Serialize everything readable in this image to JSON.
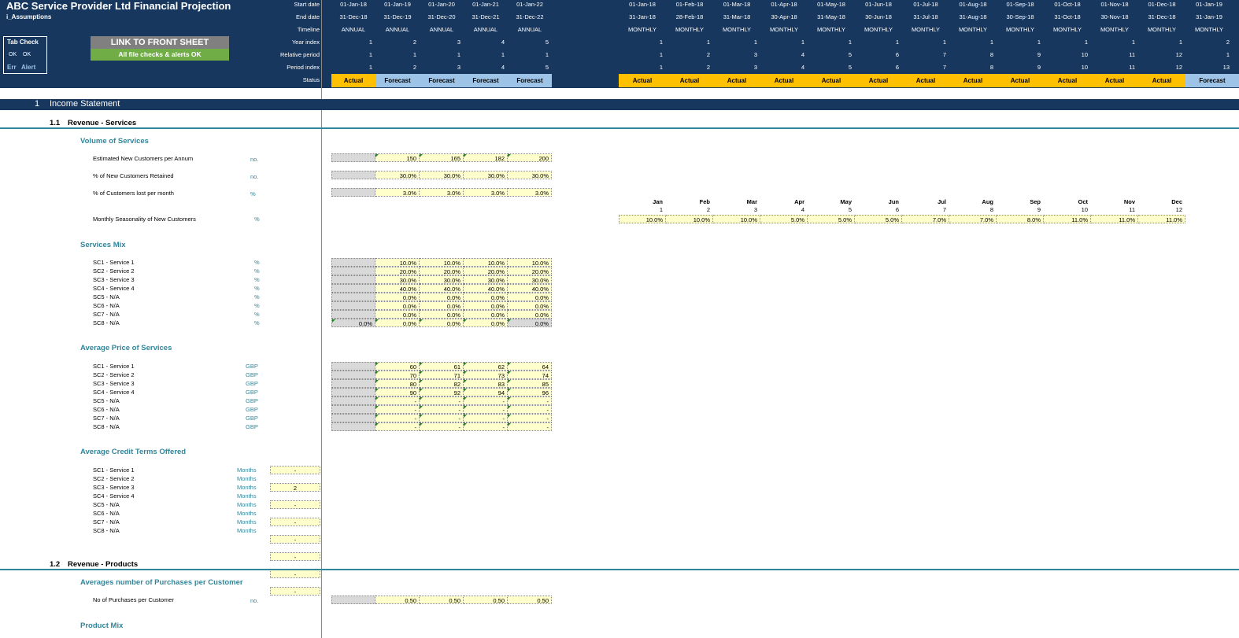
{
  "app": {
    "title": "ABC Service Provider Ltd Financial Projection",
    "sheet_name": "i_Assumptions"
  },
  "tab_check": {
    "title": "Tab Check",
    "ok1": "OK",
    "ok2": "OK",
    "err": "Err",
    "alert": "Alert"
  },
  "buttons": {
    "link_front_sheet": "LINK TO FRONT SHEET",
    "file_checks": "All file checks & alerts OK"
  },
  "header_labels": [
    "Start date",
    "End date",
    "Timeline",
    "Year index",
    "Relative period",
    "Period index",
    "Status"
  ],
  "annual": {
    "start": [
      "01-Jan-18",
      "01-Jan-19",
      "01-Jan-20",
      "01-Jan-21",
      "01-Jan-22"
    ],
    "end": [
      "31-Dec-18",
      "31-Dec-19",
      "31-Dec-20",
      "31-Dec-21",
      "31-Dec-22"
    ],
    "timeline": [
      "ANNUAL",
      "ANNUAL",
      "ANNUAL",
      "ANNUAL",
      "ANNUAL"
    ],
    "year_index": [
      "1",
      "2",
      "3",
      "4",
      "5"
    ],
    "relative": [
      "1",
      "1",
      "1",
      "1",
      "1"
    ],
    "period": [
      "1",
      "2",
      "3",
      "4",
      "5"
    ],
    "status": [
      "Actual",
      "Forecast",
      "Forecast",
      "Forecast",
      "Forecast"
    ]
  },
  "monthly": {
    "start": [
      "01-Jan-18",
      "01-Feb-18",
      "01-Mar-18",
      "01-Apr-18",
      "01-May-18",
      "01-Jun-18",
      "01-Jul-18",
      "01-Aug-18",
      "01-Sep-18",
      "01-Oct-18",
      "01-Nov-18",
      "01-Dec-18",
      "01-Jan-19"
    ],
    "end": [
      "31-Jan-18",
      "28-Feb-18",
      "31-Mar-18",
      "30-Apr-18",
      "31-May-18",
      "30-Jun-18",
      "31-Jul-18",
      "31-Aug-18",
      "30-Sep-18",
      "31-Oct-18",
      "30-Nov-18",
      "31-Dec-18",
      "31-Jan-19"
    ],
    "timeline": [
      "MONTHLY",
      "MONTHLY",
      "MONTHLY",
      "MONTHLY",
      "MONTHLY",
      "MONTHLY",
      "MONTHLY",
      "MONTHLY",
      "MONTHLY",
      "MONTHLY",
      "MONTHLY",
      "MONTHLY",
      "MONTHLY"
    ],
    "year_index": [
      "1",
      "1",
      "1",
      "1",
      "1",
      "1",
      "1",
      "1",
      "1",
      "1",
      "1",
      "1",
      "2"
    ],
    "relative": [
      "1",
      "2",
      "3",
      "4",
      "5",
      "6",
      "7",
      "8",
      "9",
      "10",
      "11",
      "12",
      "1"
    ],
    "period": [
      "1",
      "2",
      "3",
      "4",
      "5",
      "6",
      "7",
      "8",
      "9",
      "10",
      "11",
      "12",
      "13"
    ],
    "status": [
      "Actual",
      "Actual",
      "Actual",
      "Actual",
      "Actual",
      "Actual",
      "Actual",
      "Actual",
      "Actual",
      "Actual",
      "Actual",
      "Actual",
      "Forecast"
    ]
  },
  "sections": {
    "s1_num": "1",
    "s1_title": "Income Statement",
    "s11_num": "1.1",
    "s11_title": "Revenue - Services",
    "s12_num": "1.2",
    "s12_title": "Revenue - Products"
  },
  "volume": {
    "title": "Volume of Services",
    "rows": [
      {
        "label": "Estimated New Customers per Annum",
        "unit": "no.",
        "values": [
          "150",
          "165",
          "182",
          "200"
        ]
      },
      {
        "label": "% of New Customers Retained",
        "unit": "no.",
        "values": [
          "30.0%",
          "30.0%",
          "30.0%",
          "30.0%"
        ]
      },
      {
        "label": "% of Customers lost per month",
        "unit": "%",
        "values": [
          "3.0%",
          "3.0%",
          "3.0%",
          "3.0%"
        ]
      }
    ],
    "seasonality_label": "Monthly Seasonality of New Customers",
    "seasonality_unit": "%",
    "months": [
      "Jan",
      "Feb",
      "Mar",
      "Apr",
      "May",
      "Jun",
      "Jul",
      "Aug",
      "Sep",
      "Oct",
      "Nov",
      "Dec"
    ],
    "month_idx": [
      "1",
      "2",
      "3",
      "4",
      "5",
      "6",
      "7",
      "8",
      "9",
      "10",
      "11",
      "12"
    ],
    "seasonality": [
      "10.0%",
      "10.0%",
      "10.0%",
      "5.0%",
      "5.0%",
      "5.0%",
      "7.0%",
      "7.0%",
      "8.0%",
      "11.0%",
      "11.0%",
      "11.0%"
    ]
  },
  "mix": {
    "title": "Services Mix",
    "rows": [
      {
        "label": "SC1 - Service 1",
        "unit": "%",
        "values": [
          "10.0%",
          "10.0%",
          "10.0%",
          "10.0%"
        ]
      },
      {
        "label": "SC2 - Service 2",
        "unit": "%",
        "values": [
          "20.0%",
          "20.0%",
          "20.0%",
          "20.0%"
        ]
      },
      {
        "label": "SC3 - Service 3",
        "unit": "%",
        "values": [
          "30.0%",
          "30.0%",
          "30.0%",
          "30.0%"
        ]
      },
      {
        "label": "SC4 - Service 4",
        "unit": "%",
        "values": [
          "40.0%",
          "40.0%",
          "40.0%",
          "40.0%"
        ]
      },
      {
        "label": "SC5 - N/A",
        "unit": "%",
        "values": [
          "0.0%",
          "0.0%",
          "0.0%",
          "0.0%"
        ]
      },
      {
        "label": "SC6 - N/A",
        "unit": "%",
        "values": [
          "0.0%",
          "0.0%",
          "0.0%",
          "0.0%"
        ]
      },
      {
        "label": "SC7 - N/A",
        "unit": "%",
        "values": [
          "0.0%",
          "0.0%",
          "0.0%",
          "0.0%"
        ]
      },
      {
        "label": "SC8 - N/A",
        "unit": "%",
        "values": [
          "0.0%",
          "0.0%",
          "0.0%",
          "0.0%",
          "0.0%"
        ]
      }
    ]
  },
  "price": {
    "title": "Average Price of Services",
    "rows": [
      {
        "label": "SC1 - Service 1",
        "unit": "GBP",
        "values": [
          "60",
          "61",
          "62",
          "64"
        ]
      },
      {
        "label": "SC2 - Service 2",
        "unit": "GBP",
        "values": [
          "70",
          "71",
          "73",
          "74"
        ]
      },
      {
        "label": "SC3 - Service 3",
        "unit": "GBP",
        "values": [
          "80",
          "82",
          "83",
          "85"
        ]
      },
      {
        "label": "SC4 - Service 4",
        "unit": "GBP",
        "values": [
          "90",
          "92",
          "94",
          "96"
        ]
      },
      {
        "label": "SC5 - N/A",
        "unit": "GBP",
        "values": [
          "-",
          "-",
          "-",
          "-"
        ]
      },
      {
        "label": "SC6 - N/A",
        "unit": "GBP",
        "values": [
          "-",
          "-",
          "-",
          "-"
        ]
      },
      {
        "label": "SC7 - N/A",
        "unit": "GBP",
        "values": [
          "-",
          "-",
          "-",
          "-"
        ]
      },
      {
        "label": "SC8 - N/A",
        "unit": "GBP",
        "values": [
          "-",
          "-",
          "-",
          "-"
        ]
      }
    ]
  },
  "credit": {
    "title": "Average Credit Terms Offered",
    "rows": [
      {
        "label": "SC1 - Service 1",
        "unit": "Months",
        "value": "-"
      },
      {
        "label": "SC2 - Service 2",
        "unit": "Months",
        "value": "2"
      },
      {
        "label": "SC3 - Service 3",
        "unit": "Months",
        "value": "-"
      },
      {
        "label": "SC4 - Service 4",
        "unit": "Months",
        "value": "-"
      },
      {
        "label": "SC5 - N/A",
        "unit": "Months",
        "value": "-"
      },
      {
        "label": "SC6 - N/A",
        "unit": "Months",
        "value": "-"
      },
      {
        "label": "SC7 - N/A",
        "unit": "Months",
        "value": "-"
      },
      {
        "label": "SC8 - N/A",
        "unit": "Months",
        "value": "-"
      }
    ]
  },
  "purchases": {
    "title": "Averages number of Purchases per Customer",
    "row_label": "No of Purchases per Customer",
    "unit": "no.",
    "values": [
      "0.50",
      "0.50",
      "0.50",
      "0.50"
    ]
  },
  "product_mix": {
    "title": "Product Mix"
  },
  "colors": {
    "header_navy": "#17375e",
    "teal": "#31869b",
    "actual": "#ffc000",
    "forecast": "#9dc3e6",
    "input_yellow": "#ffffcc",
    "ok_green": "#70ad47"
  }
}
